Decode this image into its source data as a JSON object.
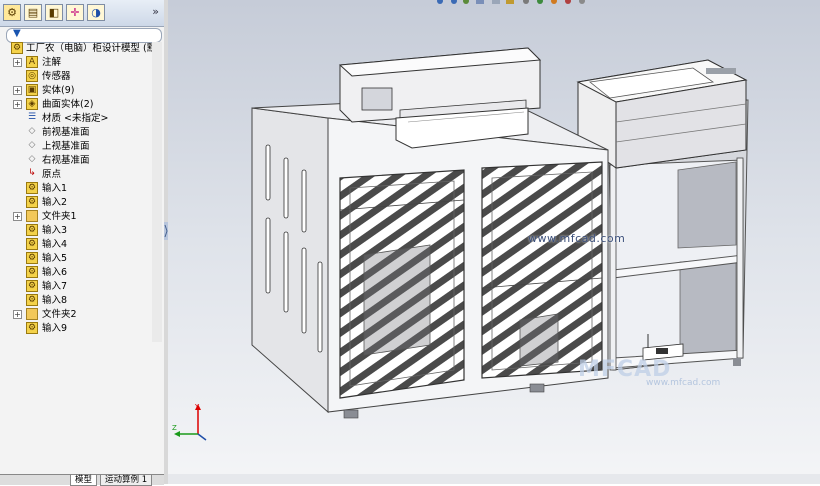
{
  "panel": {
    "tabs": [
      "feature-manager",
      "property-manager",
      "configuration-manager",
      "dimxpert-manager",
      "display-manager"
    ],
    "overflow_glyph": "»",
    "filter_glyph": "▼"
  },
  "tree": {
    "root": {
      "label": "工厂农（电脑）柜设计模型  (默",
      "icon": "part-icon"
    },
    "items": [
      {
        "label": "注解",
        "icon": "annotation-icon",
        "expand": "+"
      },
      {
        "label": "传感器",
        "icon": "sensor-icon",
        "expand": ""
      },
      {
        "label": "实体(9)",
        "icon": "solid-bodies-icon",
        "expand": "+"
      },
      {
        "label": "曲面实体(2)",
        "icon": "surface-bodies-icon",
        "expand": "+"
      },
      {
        "label": "材质 <未指定>",
        "icon": "material-icon",
        "expand": ""
      },
      {
        "label": "前视基准面",
        "icon": "plane-icon",
        "expand": ""
      },
      {
        "label": "上视基准面",
        "icon": "plane-icon",
        "expand": ""
      },
      {
        "label": "右视基准面",
        "icon": "plane-icon",
        "expand": ""
      },
      {
        "label": "原点",
        "icon": "origin-icon",
        "expand": ""
      },
      {
        "label": "输入1",
        "icon": "imported-feature-icon",
        "expand": ""
      },
      {
        "label": "输入2",
        "icon": "imported-feature-icon",
        "expand": ""
      },
      {
        "label": "文件夹1",
        "icon": "folder-icon",
        "expand": "+"
      },
      {
        "label": "输入3",
        "icon": "imported-feature-icon",
        "expand": ""
      },
      {
        "label": "输入4",
        "icon": "imported-feature-icon",
        "expand": ""
      },
      {
        "label": "输入5",
        "icon": "imported-feature-icon",
        "expand": ""
      },
      {
        "label": "输入6",
        "icon": "imported-feature-icon",
        "expand": ""
      },
      {
        "label": "输入7",
        "icon": "imported-feature-icon",
        "expand": ""
      },
      {
        "label": "输入8",
        "icon": "imported-feature-icon",
        "expand": ""
      },
      {
        "label": "文件夹2",
        "icon": "folder-icon",
        "expand": "+"
      },
      {
        "label": "输入9",
        "icon": "imported-feature-icon",
        "expand": ""
      }
    ]
  },
  "bottom_tabs": [
    "模型",
    "运动算例 1"
  ],
  "viewport": {
    "watermark": "www.mfcad.com",
    "logo": "MFCAD",
    "logo_sub": "www.mfcad.com",
    "triad": {
      "x": "X",
      "y": "Y",
      "z": "Z"
    }
  },
  "colors": {
    "accent_blue": "#1f4ea8",
    "icon_yellow": "#f4d24a",
    "viewport_top": "#c6ccd8",
    "viewport_bottom": "#f4f5f7"
  }
}
